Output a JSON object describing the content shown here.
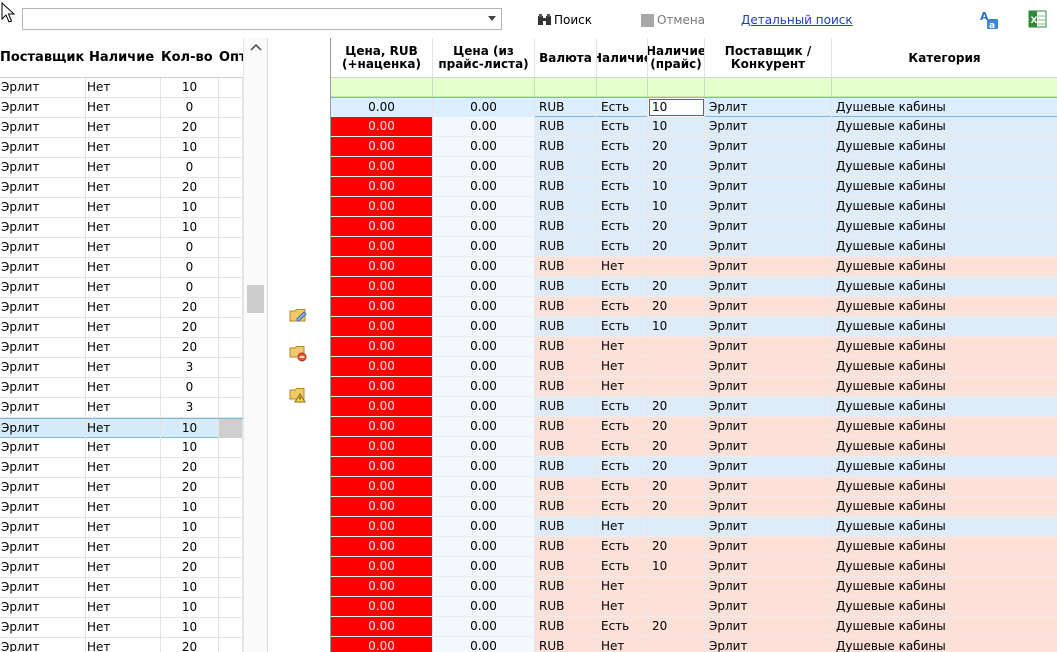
{
  "toolbar": {
    "combo_value": "",
    "search_label": "Поиск",
    "cancel_label": "Отмена",
    "advanced_search_label": "Детальный поиск"
  },
  "left_grid": {
    "columns": [
      "Поставщик",
      "Наличие",
      "Кол-во",
      "Опт"
    ],
    "rows": [
      [
        "Эрлит",
        "Нет",
        "10"
      ],
      [
        "Эрлит",
        "Нет",
        "0"
      ],
      [
        "Эрлит",
        "Нет",
        "20"
      ],
      [
        "Эрлит",
        "Нет",
        "10"
      ],
      [
        "Эрлит",
        "Нет",
        "0"
      ],
      [
        "Эрлит",
        "Нет",
        "20"
      ],
      [
        "Эрлит",
        "Нет",
        "10"
      ],
      [
        "Эрлит",
        "Нет",
        "10"
      ],
      [
        "Эрлит",
        "Нет",
        "0"
      ],
      [
        "Эрлит",
        "Нет",
        "0"
      ],
      [
        "Эрлит",
        "Нет",
        "0"
      ],
      [
        "Эрлит",
        "Нет",
        "20"
      ],
      [
        "Эрлит",
        "Нет",
        "20"
      ],
      [
        "Эрлит",
        "Нет",
        "20"
      ],
      [
        "Эрлит",
        "Нет",
        "3"
      ],
      [
        "Эрлит",
        "Нет",
        "0"
      ],
      [
        "Эрлит",
        "Нет",
        "3"
      ],
      [
        "Эрлит",
        "Нет",
        "10"
      ],
      [
        "Эрлит",
        "Нет",
        "10"
      ],
      [
        "Эрлит",
        "Нет",
        "20"
      ],
      [
        "Эрлит",
        "Нет",
        "20"
      ],
      [
        "Эрлит",
        "Нет",
        "10"
      ],
      [
        "Эрлит",
        "Нет",
        "10"
      ],
      [
        "Эрлит",
        "Нет",
        "20"
      ],
      [
        "Эрлит",
        "Нет",
        "20"
      ],
      [
        "Эрлит",
        "Нет",
        "10"
      ],
      [
        "Эрлит",
        "Нет",
        "10"
      ],
      [
        "Эрлит",
        "Нет",
        "10"
      ],
      [
        "Эрлит",
        "Нет",
        "20"
      ]
    ],
    "selected_index": 17
  },
  "right_grid": {
    "columns": [
      "Цена, RUB\n(+наценка)",
      "Цена (из\nпрайс-листа)",
      "Валюта",
      "Наличие",
      "Наличие\n(прайс)",
      "Поставщик /\nКонкурент",
      "Категория"
    ],
    "rows": [
      [
        "0.00",
        "0.00",
        "RUB",
        "Есть",
        "10",
        "Эрлит",
        "Душевые кабины"
      ],
      [
        "0.00",
        "0.00",
        "RUB",
        "Есть",
        "10",
        "Эрлит",
        "Душевые кабины"
      ],
      [
        "0.00",
        "0.00",
        "RUB",
        "Есть",
        "20",
        "Эрлит",
        "Душевые кабины"
      ],
      [
        "0.00",
        "0.00",
        "RUB",
        "Есть",
        "20",
        "Эрлит",
        "Душевые кабины"
      ],
      [
        "0.00",
        "0.00",
        "RUB",
        "Есть",
        "10",
        "Эрлит",
        "Душевые кабины"
      ],
      [
        "0.00",
        "0.00",
        "RUB",
        "Есть",
        "10",
        "Эрлит",
        "Душевые кабины"
      ],
      [
        "0.00",
        "0.00",
        "RUB",
        "Есть",
        "20",
        "Эрлит",
        "Душевые кабины"
      ],
      [
        "0.00",
        "0.00",
        "RUB",
        "Есть",
        "20",
        "Эрлит",
        "Душевые кабины"
      ],
      [
        "0.00",
        "0.00",
        "RUB",
        "Нет",
        "",
        "Эрлит",
        "Душевые кабины"
      ],
      [
        "0.00",
        "0.00",
        "RUB",
        "Есть",
        "20",
        "Эрлит",
        "Душевые кабины"
      ],
      [
        "0.00",
        "0.00",
        "RUB",
        "Есть",
        "20",
        "Эрлит",
        "Душевые кабины"
      ],
      [
        "0.00",
        "0.00",
        "RUB",
        "Есть",
        "10",
        "Эрлит",
        "Душевые кабины"
      ],
      [
        "0.00",
        "0.00",
        "RUB",
        "Нет",
        "",
        "Эрлит",
        "Душевые кабины"
      ],
      [
        "0.00",
        "0.00",
        "RUB",
        "Нет",
        "",
        "Эрлит",
        "Душевые кабины"
      ],
      [
        "0.00",
        "0.00",
        "RUB",
        "Нет",
        "",
        "Эрлит",
        "Душевые кабины"
      ],
      [
        "0.00",
        "0.00",
        "RUB",
        "Есть",
        "20",
        "Эрлит",
        "Душевые кабины"
      ],
      [
        "0.00",
        "0.00",
        "RUB",
        "Есть",
        "20",
        "Эрлит",
        "Душевые кабины"
      ],
      [
        "0.00",
        "0.00",
        "RUB",
        "Есть",
        "20",
        "Эрлит",
        "Душевые кабины"
      ],
      [
        "0.00",
        "0.00",
        "RUB",
        "Есть",
        "20",
        "Эрлит",
        "Душевые кабины"
      ],
      [
        "0.00",
        "0.00",
        "RUB",
        "Есть",
        "20",
        "Эрлит",
        "Душевые кабины"
      ],
      [
        "0.00",
        "0.00",
        "RUB",
        "Есть",
        "20",
        "Эрлит",
        "Душевые кабины"
      ],
      [
        "0.00",
        "0.00",
        "RUB",
        "Нет",
        "",
        "Эрлит",
        "Душевые кабины"
      ],
      [
        "0.00",
        "0.00",
        "RUB",
        "Есть",
        "20",
        "Эрлит",
        "Душевые кабины"
      ],
      [
        "0.00",
        "0.00",
        "RUB",
        "Есть",
        "10",
        "Эрлит",
        "Душевые кабины"
      ],
      [
        "0.00",
        "0.00",
        "RUB",
        "Нет",
        "",
        "Эрлит",
        "Душевые кабины"
      ],
      [
        "0.00",
        "0.00",
        "RUB",
        "Нет",
        "",
        "Эрлит",
        "Душевые кабины"
      ],
      [
        "0.00",
        "0.00",
        "RUB",
        "Есть",
        "20",
        "Эрлит",
        "Душевые кабины"
      ],
      [
        "0.00",
        "0.00",
        "RUB",
        "Нет",
        "",
        "Эрлит",
        "Душевые кабины"
      ]
    ],
    "row_tints": [
      "sel",
      "blue",
      "blue",
      "blue",
      "blue",
      "blue",
      "blue",
      "blue",
      "pink",
      "blue",
      "pink",
      "blue",
      "pink",
      "pink",
      "pink",
      "blue",
      "pink",
      "pink",
      "blue",
      "pink",
      "pink",
      "blue",
      "pink",
      "pink",
      "pink",
      "pink",
      "pink",
      "pink"
    ],
    "selected_index": 0,
    "editing_value": "10"
  },
  "colors": {
    "price_cell": "#fe0000",
    "row_blue": "#deebf8",
    "row_pink": "#fde0d7",
    "row_selected": "#dcefff",
    "filter_row": "#e6ffcd",
    "link": "#1f3fbf"
  },
  "icons": {
    "search_icon": "binoculars-icon",
    "lang_icon": "translate-icon",
    "export_icon": "export-excel-icon",
    "middle_icons": [
      "folder-edit-icon",
      "folder-remove-icon",
      "folder-warning-icon"
    ]
  }
}
